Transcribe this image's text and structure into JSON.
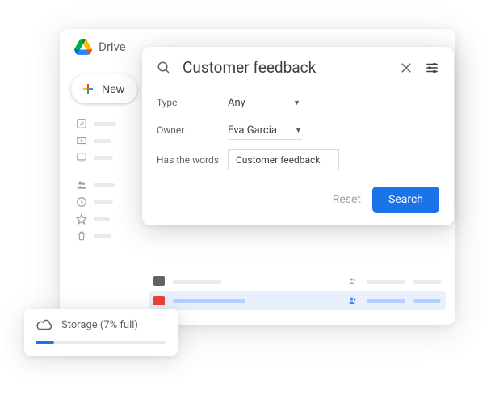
{
  "app": {
    "title": "Drive"
  },
  "new_button": {
    "label": "New"
  },
  "search": {
    "query": "Customer feedback",
    "filters": {
      "type_label": "Type",
      "type_value": "Any",
      "owner_label": "Owner",
      "owner_value": "Eva Garcia",
      "haswords_label": "Has the words",
      "haswords_value": "Customer feedback"
    },
    "reset_label": "Reset",
    "search_label": "Search"
  },
  "storage": {
    "label": "Storage (7% full)",
    "percent": 7
  },
  "colors": {
    "accent": "#1a73e8"
  }
}
